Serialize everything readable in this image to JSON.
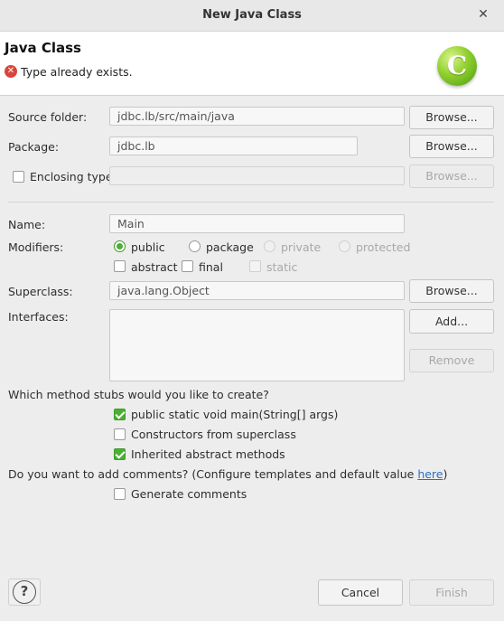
{
  "window": {
    "title": "New Java Class",
    "bg_ghost_text": ""
  },
  "banner": {
    "title": "Java Class",
    "error_message": "Type already exists.",
    "icon": "new-class-wizard-icon",
    "icon_letter": "C"
  },
  "form": {
    "source_folder": {
      "label": "Source folder:",
      "value": "jdbc.lb/src/main/java",
      "button": "Browse..."
    },
    "package": {
      "label": "Package:",
      "value": "jdbc.lb",
      "button": "Browse..."
    },
    "enclosing_type": {
      "label": "Enclosing type:",
      "value": "",
      "button": "Browse...",
      "checked": false
    },
    "name": {
      "label": "Name:",
      "value": "Main"
    },
    "modifiers": {
      "label": "Modifiers:",
      "visibility": [
        {
          "label": "public",
          "selected": true,
          "enabled": true
        },
        {
          "label": "package",
          "selected": false,
          "enabled": true
        },
        {
          "label": "private",
          "selected": false,
          "enabled": false
        },
        {
          "label": "protected",
          "selected": false,
          "enabled": false
        }
      ],
      "flags": [
        {
          "label": "abstract",
          "checked": false,
          "enabled": true
        },
        {
          "label": "final",
          "checked": false,
          "enabled": true
        },
        {
          "label": "static",
          "checked": false,
          "enabled": false
        }
      ]
    },
    "superclass": {
      "label": "Superclass:",
      "value": "java.lang.Object",
      "button": "Browse..."
    },
    "interfaces": {
      "label": "Interfaces:",
      "add_button": "Add...",
      "remove_button": "Remove"
    }
  },
  "stubs": {
    "question": "Which method stubs would you like to create?",
    "options": [
      {
        "label": "public static void main(String[] args)",
        "checked": true
      },
      {
        "label": "Constructors from superclass",
        "checked": false
      },
      {
        "label": "Inherited abstract methods",
        "checked": true
      }
    ]
  },
  "comments": {
    "question_prefix": "Do you want to add comments? (Configure templates and default value ",
    "link": "here",
    "question_suffix": ")",
    "option": {
      "label": "Generate comments",
      "checked": false
    }
  },
  "footer": {
    "help": "?",
    "cancel": "Cancel",
    "finish": "Finish"
  },
  "colors": {
    "accent_green": "#4caf35",
    "error_red": "#d9453a",
    "link_blue": "#2a6fc4"
  }
}
